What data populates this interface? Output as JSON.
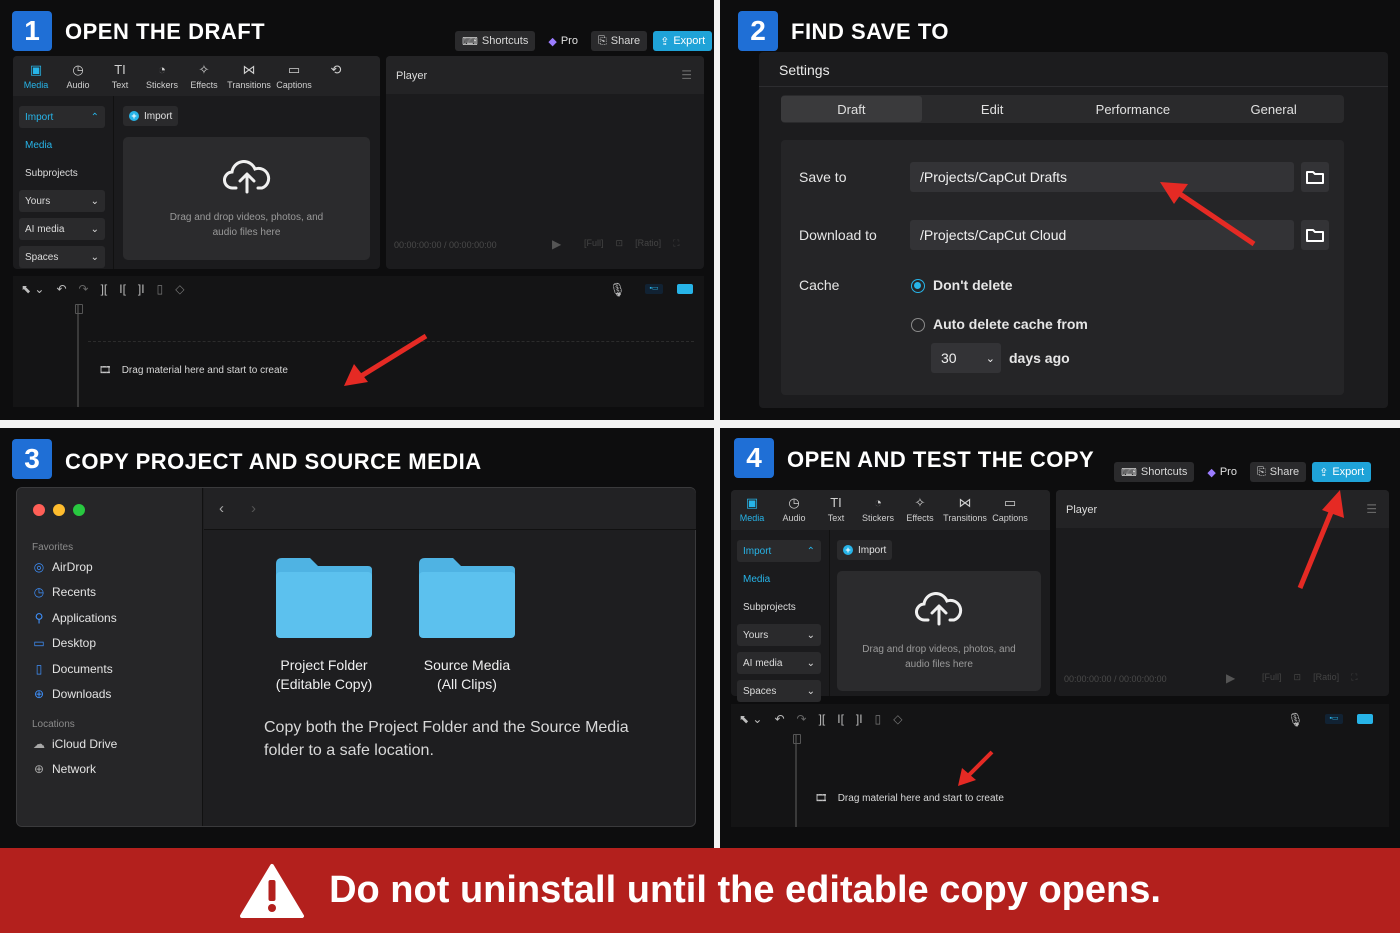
{
  "steps": [
    {
      "number": "1",
      "title": "OPEN THE DRAFT"
    },
    {
      "number": "2",
      "title": "FIND SAVE TO"
    },
    {
      "number": "3",
      "title": "COPY PROJECT AND SOURCE MEDIA"
    },
    {
      "number": "4",
      "title": "OPEN AND TEST THE COPY"
    }
  ],
  "capcut": {
    "top_buttons": {
      "shortcuts": "Shortcuts",
      "pro": "Pro",
      "share": "Share",
      "export": "Export"
    },
    "tabs": [
      {
        "label": "Media",
        "icon": "media-icon"
      },
      {
        "label": "Audio",
        "icon": "audio-icon"
      },
      {
        "label": "Text",
        "icon": "text-icon"
      },
      {
        "label": "Stickers",
        "icon": "stickers-icon"
      },
      {
        "label": "Effects",
        "icon": "effects-icon"
      },
      {
        "label": "Transitions",
        "icon": "transitions-icon"
      },
      {
        "label": "Captions",
        "icon": "captions-icon"
      }
    ],
    "sidebar": [
      "Import",
      "Media",
      "Subprojects",
      "Yours",
      "AI media",
      "Spaces"
    ],
    "import_button": "Import",
    "drop_text_1": "Drag and drop videos, photos, and",
    "drop_text_2": "audio files here",
    "player_title": "Player",
    "timecode": "00:00:00:00 / 00:00:00:00",
    "timeline_hint": "Drag material here and start to create",
    "accent_color": "#27b4e8"
  },
  "settings": {
    "title": "Settings",
    "tabs": [
      "Draft",
      "Edit",
      "Performance",
      "General"
    ],
    "save_to_label": "Save to",
    "save_to_value": "/Projects/CapCut Drafts",
    "download_to_label": "Download to",
    "download_to_value": "/Projects/CapCut Cloud",
    "cache_label": "Cache",
    "cache_option_1": "Don't delete",
    "cache_option_2": "Auto delete cache from",
    "days_value": "30",
    "days_suffix": "days ago"
  },
  "finder": {
    "favorites_heading": "Favorites",
    "favorites": [
      "AirDrop",
      "Recents",
      "Applications",
      "Desktop",
      "Documents",
      "Downloads"
    ],
    "locations_heading": "Locations",
    "locations": [
      "iCloud Drive",
      "Network"
    ],
    "folders": [
      {
        "line1": "Project Folder",
        "line2": "(Editable Copy)"
      },
      {
        "line1": "Source Media",
        "line2": "(All Clips)"
      }
    ],
    "note_line1": "Copy both the Project Folder and the Source Media",
    "note_line2": "folder to a safe location.",
    "folder_color": "#5cc1ee"
  },
  "banner": {
    "text": "Do not uninstall until the editable copy opens.",
    "color": "#b3201d"
  },
  "badge_color": "#1f6fd6",
  "arrow_color": "#e52a24"
}
